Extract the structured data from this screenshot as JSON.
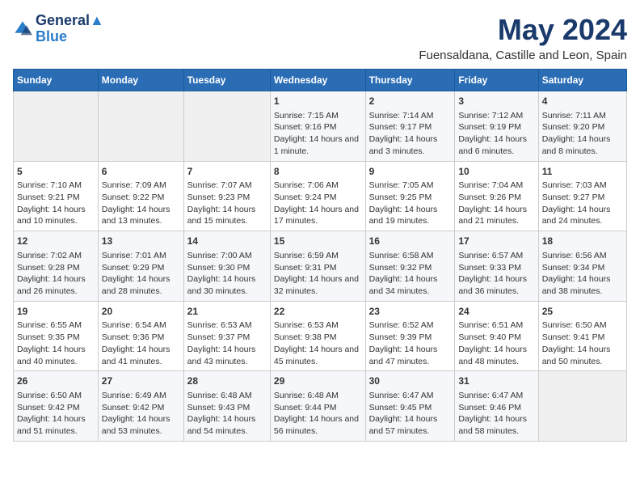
{
  "logo": {
    "line1": "General",
    "line2": "Blue"
  },
  "title": "May 2024",
  "subtitle": "Fuensaldana, Castille and Leon, Spain",
  "weekdays": [
    "Sunday",
    "Monday",
    "Tuesday",
    "Wednesday",
    "Thursday",
    "Friday",
    "Saturday"
  ],
  "weeks": [
    [
      {
        "day": "",
        "empty": true
      },
      {
        "day": "",
        "empty": true
      },
      {
        "day": "",
        "empty": true
      },
      {
        "day": "1",
        "sunrise": "7:15 AM",
        "sunset": "9:16 PM",
        "daylight": "14 hours and 1 minute."
      },
      {
        "day": "2",
        "sunrise": "7:14 AM",
        "sunset": "9:17 PM",
        "daylight": "14 hours and 3 minutes."
      },
      {
        "day": "3",
        "sunrise": "7:12 AM",
        "sunset": "9:19 PM",
        "daylight": "14 hours and 6 minutes."
      },
      {
        "day": "4",
        "sunrise": "7:11 AM",
        "sunset": "9:20 PM",
        "daylight": "14 hours and 8 minutes."
      }
    ],
    [
      {
        "day": "5",
        "sunrise": "7:10 AM",
        "sunset": "9:21 PM",
        "daylight": "14 hours and 10 minutes."
      },
      {
        "day": "6",
        "sunrise": "7:09 AM",
        "sunset": "9:22 PM",
        "daylight": "14 hours and 13 minutes."
      },
      {
        "day": "7",
        "sunrise": "7:07 AM",
        "sunset": "9:23 PM",
        "daylight": "14 hours and 15 minutes."
      },
      {
        "day": "8",
        "sunrise": "7:06 AM",
        "sunset": "9:24 PM",
        "daylight": "14 hours and 17 minutes."
      },
      {
        "day": "9",
        "sunrise": "7:05 AM",
        "sunset": "9:25 PM",
        "daylight": "14 hours and 19 minutes."
      },
      {
        "day": "10",
        "sunrise": "7:04 AM",
        "sunset": "9:26 PM",
        "daylight": "14 hours and 21 minutes."
      },
      {
        "day": "11",
        "sunrise": "7:03 AM",
        "sunset": "9:27 PM",
        "daylight": "14 hours and 24 minutes."
      }
    ],
    [
      {
        "day": "12",
        "sunrise": "7:02 AM",
        "sunset": "9:28 PM",
        "daylight": "14 hours and 26 minutes."
      },
      {
        "day": "13",
        "sunrise": "7:01 AM",
        "sunset": "9:29 PM",
        "daylight": "14 hours and 28 minutes."
      },
      {
        "day": "14",
        "sunrise": "7:00 AM",
        "sunset": "9:30 PM",
        "daylight": "14 hours and 30 minutes."
      },
      {
        "day": "15",
        "sunrise": "6:59 AM",
        "sunset": "9:31 PM",
        "daylight": "14 hours and 32 minutes."
      },
      {
        "day": "16",
        "sunrise": "6:58 AM",
        "sunset": "9:32 PM",
        "daylight": "14 hours and 34 minutes."
      },
      {
        "day": "17",
        "sunrise": "6:57 AM",
        "sunset": "9:33 PM",
        "daylight": "14 hours and 36 minutes."
      },
      {
        "day": "18",
        "sunrise": "6:56 AM",
        "sunset": "9:34 PM",
        "daylight": "14 hours and 38 minutes."
      }
    ],
    [
      {
        "day": "19",
        "sunrise": "6:55 AM",
        "sunset": "9:35 PM",
        "daylight": "14 hours and 40 minutes."
      },
      {
        "day": "20",
        "sunrise": "6:54 AM",
        "sunset": "9:36 PM",
        "daylight": "14 hours and 41 minutes."
      },
      {
        "day": "21",
        "sunrise": "6:53 AM",
        "sunset": "9:37 PM",
        "daylight": "14 hours and 43 minutes."
      },
      {
        "day": "22",
        "sunrise": "6:53 AM",
        "sunset": "9:38 PM",
        "daylight": "14 hours and 45 minutes."
      },
      {
        "day": "23",
        "sunrise": "6:52 AM",
        "sunset": "9:39 PM",
        "daylight": "14 hours and 47 minutes."
      },
      {
        "day": "24",
        "sunrise": "6:51 AM",
        "sunset": "9:40 PM",
        "daylight": "14 hours and 48 minutes."
      },
      {
        "day": "25",
        "sunrise": "6:50 AM",
        "sunset": "9:41 PM",
        "daylight": "14 hours and 50 minutes."
      }
    ],
    [
      {
        "day": "26",
        "sunrise": "6:50 AM",
        "sunset": "9:42 PM",
        "daylight": "14 hours and 51 minutes."
      },
      {
        "day": "27",
        "sunrise": "6:49 AM",
        "sunset": "9:42 PM",
        "daylight": "14 hours and 53 minutes."
      },
      {
        "day": "28",
        "sunrise": "6:48 AM",
        "sunset": "9:43 PM",
        "daylight": "14 hours and 54 minutes."
      },
      {
        "day": "29",
        "sunrise": "6:48 AM",
        "sunset": "9:44 PM",
        "daylight": "14 hours and 56 minutes."
      },
      {
        "day": "30",
        "sunrise": "6:47 AM",
        "sunset": "9:45 PM",
        "daylight": "14 hours and 57 minutes."
      },
      {
        "day": "31",
        "sunrise": "6:47 AM",
        "sunset": "9:46 PM",
        "daylight": "14 hours and 58 minutes."
      },
      {
        "day": "",
        "empty": true
      }
    ]
  ]
}
